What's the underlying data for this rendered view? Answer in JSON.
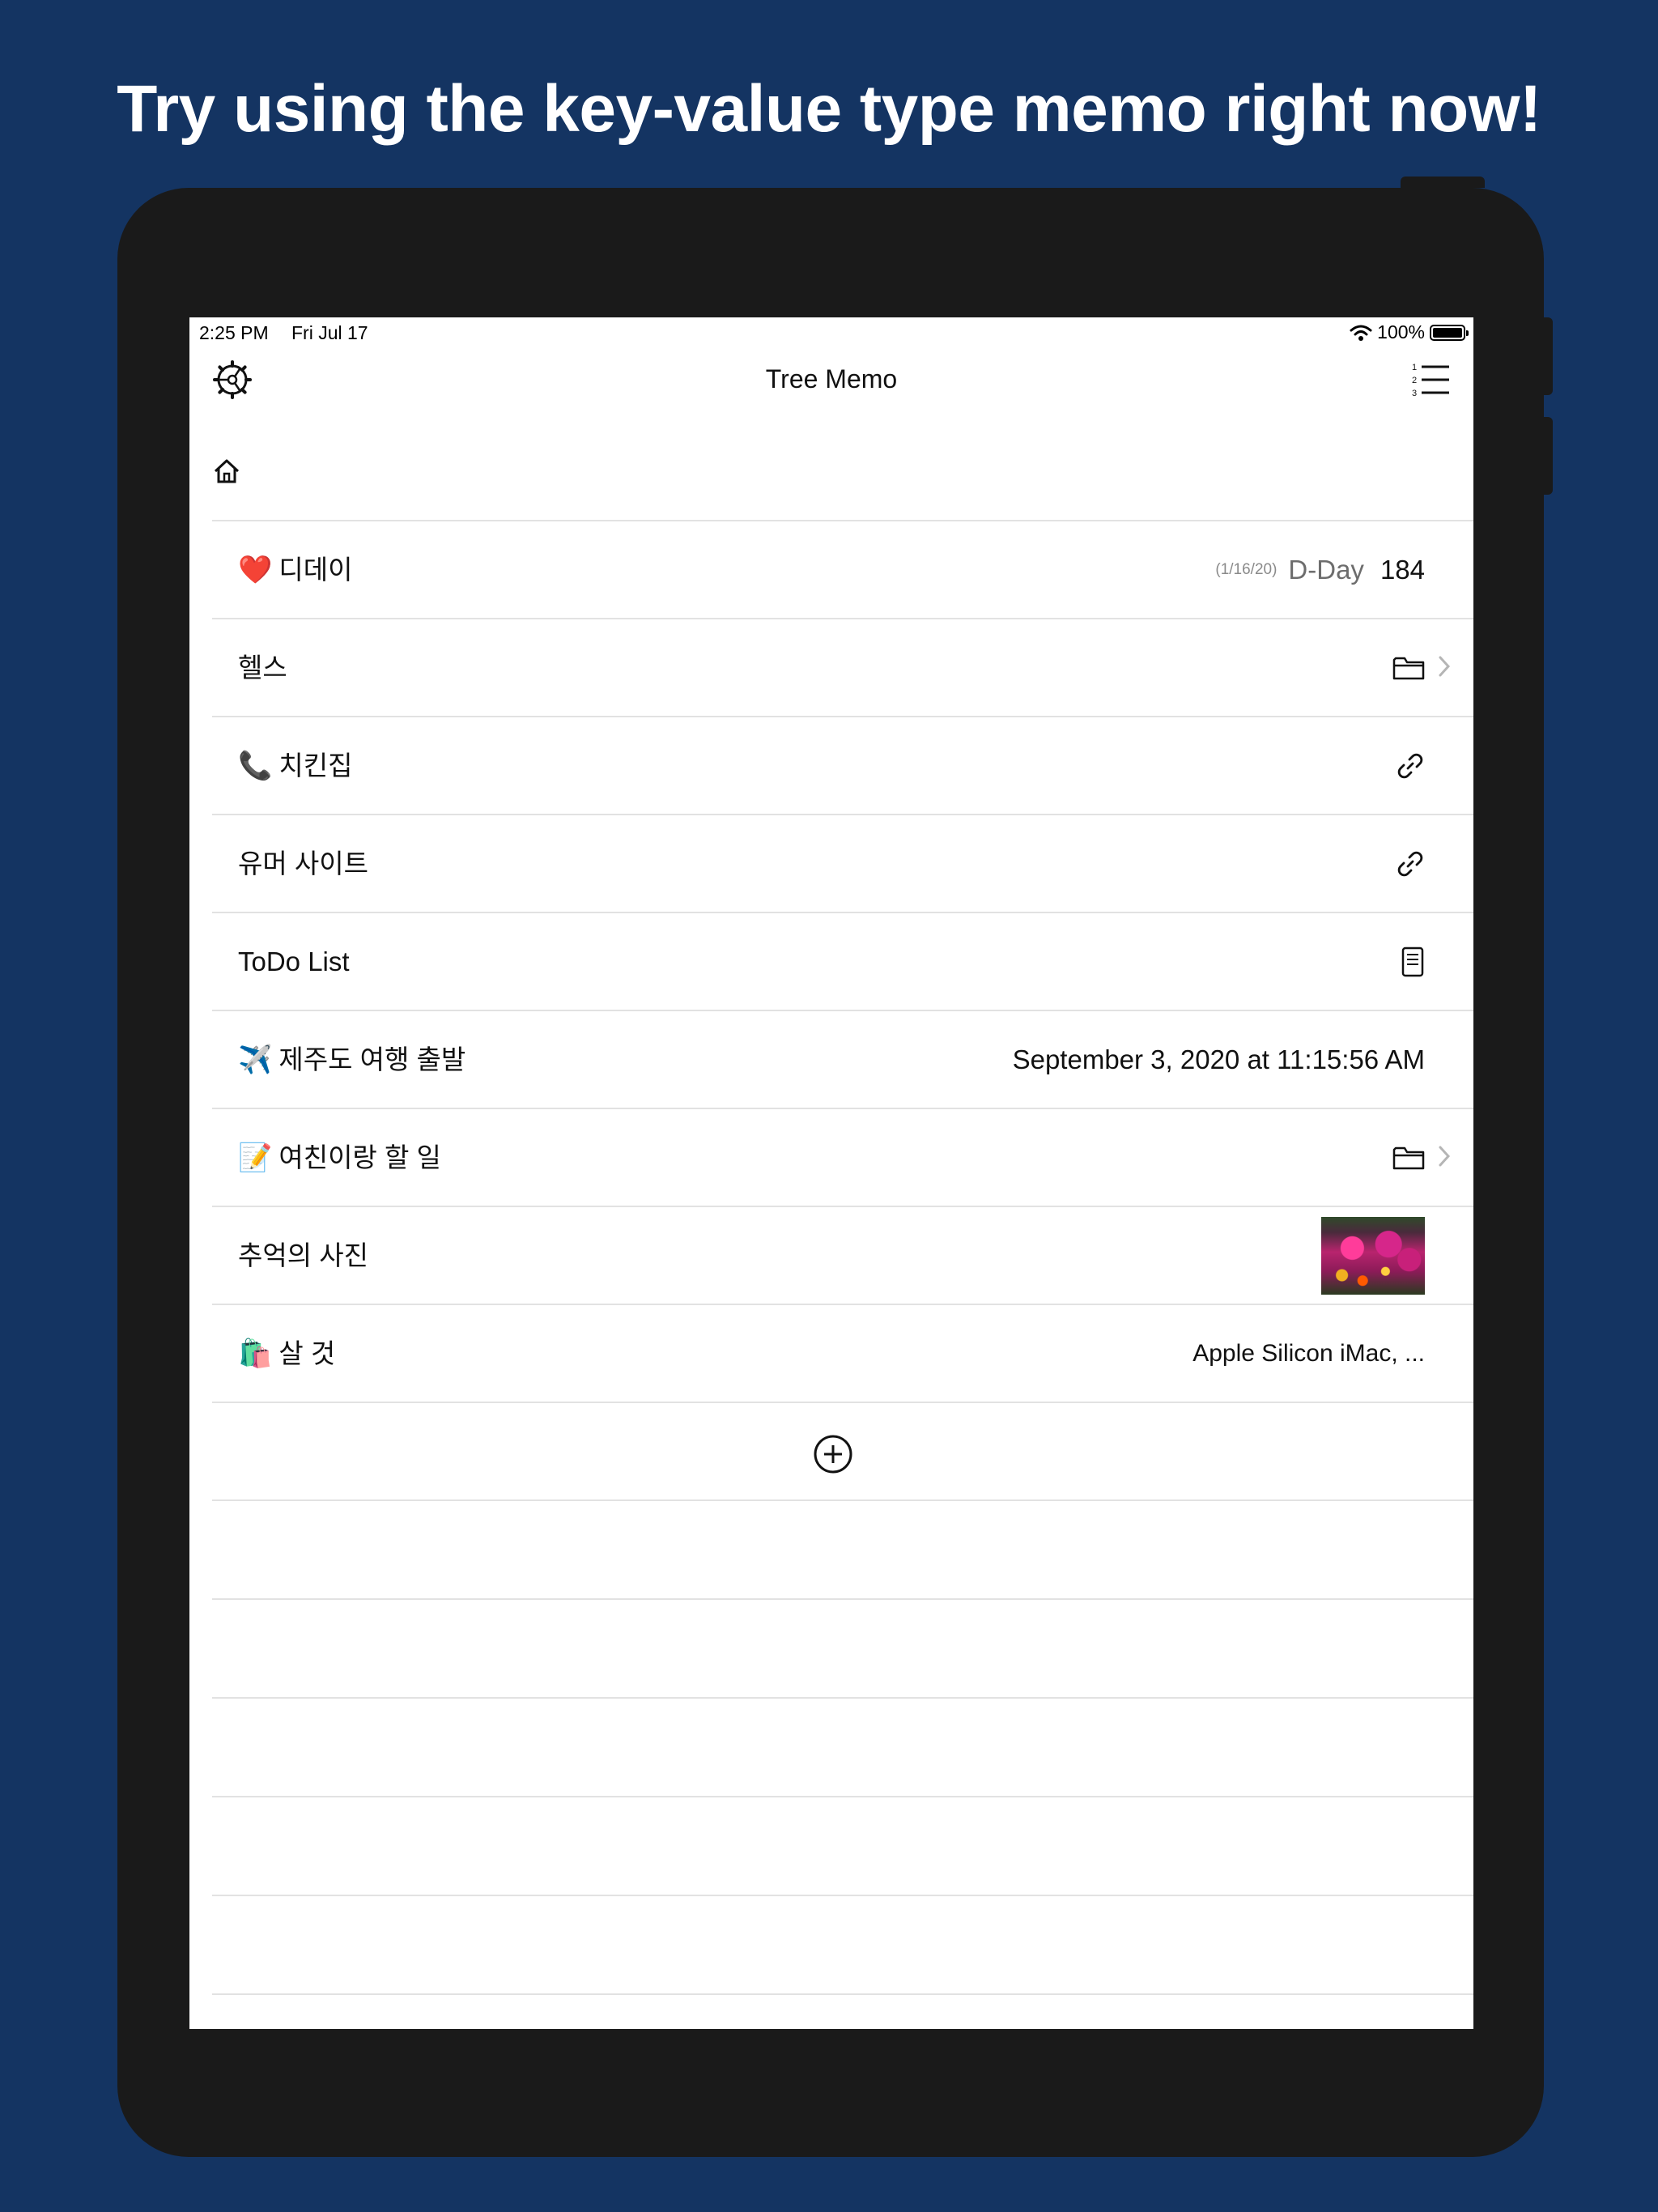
{
  "promo": {
    "headline": "Try using the key-value type memo right now!"
  },
  "colors": {
    "background": "#143462",
    "device": "#1a1a1a",
    "screen": "#ffffff",
    "separator": "#e2e2e2"
  },
  "status_bar": {
    "time": "2:25 PM",
    "date": "Fri Jul 17",
    "battery": "100%",
    "battery_level": 1.0
  },
  "nav": {
    "title": "Tree Memo",
    "left_icon": "gear-icon",
    "right_icon": "numbered-list-icon"
  },
  "breadcrumb": {
    "icon": "home-icon"
  },
  "rows": [
    {
      "emoji": "❤️",
      "key": "디데이",
      "dday_date": "(1/16/20)",
      "dday_label": "D-Day",
      "dday_value": "184"
    },
    {
      "emoji": "",
      "key": "헬스",
      "icon": "folder-icon"
    },
    {
      "emoji": "📞",
      "key": "치킨집",
      "icon": "link-icon"
    },
    {
      "emoji": "",
      "key": "유머 사이트",
      "icon": "link-icon"
    },
    {
      "emoji": "",
      "key": "ToDo List",
      "icon": "note-icon"
    },
    {
      "emoji": "✈️",
      "key": "제주도 여행 출발",
      "value": "September 3, 2020 at 11:15:56 AM"
    },
    {
      "emoji": "📝",
      "key": "여친이랑 할 일",
      "icon": "folder-icon"
    },
    {
      "emoji": "",
      "key": "추억의 사진",
      "icon": "photo-thumbnail"
    },
    {
      "emoji": "🛍️",
      "key": "살 것",
      "value": "Apple Silicon iMac, ..."
    }
  ],
  "add_button": {
    "icon": "plus-circle-icon"
  }
}
